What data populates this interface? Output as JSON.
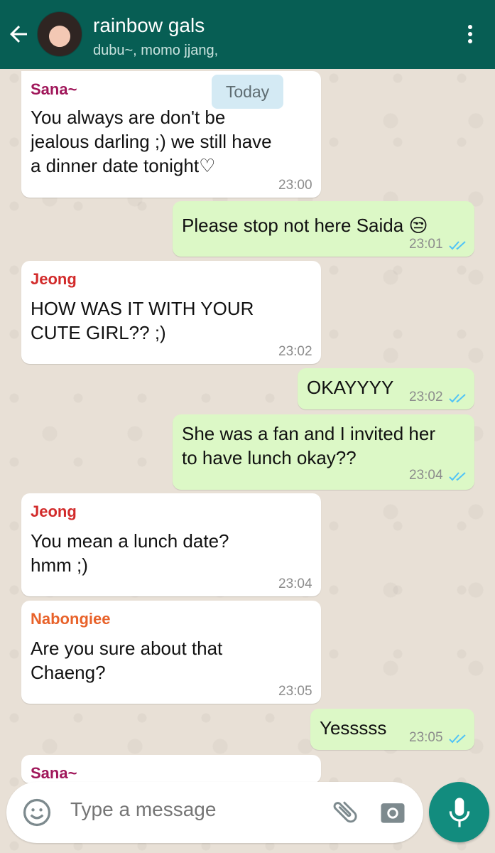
{
  "header": {
    "title": "rainbow gals",
    "subtitle": "dubu~, momo jjang,",
    "back_icon": "arrow-left-icon",
    "menu_icon": "more-vert-icon",
    "colors": {
      "bar": "#075e54",
      "text": "#ffffff"
    }
  },
  "date_chip": "Today",
  "messages": [
    {
      "direction": "incoming",
      "sender": "Sana~",
      "sender_color": "#a0175a",
      "lines": [
        "You always are don't be",
        "jealous darling ;) we still have",
        "a dinner date tonight♡"
      ],
      "time": "23:00"
    },
    {
      "direction": "outgoing",
      "lines": [
        "Please stop not here Saida 😒"
      ],
      "time": "23:01",
      "status": "read"
    },
    {
      "direction": "incoming",
      "sender": "Jeong",
      "sender_color": "#d22b2b",
      "lines": [
        "HOW WAS IT WITH YOUR",
        "CUTE GIRL?? ;)"
      ],
      "time": "23:02"
    },
    {
      "direction": "outgoing",
      "lines": [
        "OKAYYYY"
      ],
      "time": "23:02",
      "status": "read"
    },
    {
      "direction": "outgoing",
      "lines": [
        "She was a fan and I invited her",
        "to have lunch okay??"
      ],
      "time": "23:04",
      "status": "read"
    },
    {
      "direction": "incoming",
      "sender": "Jeong",
      "sender_color": "#d22b2b",
      "lines": [
        "You mean a lunch date?",
        "hmm ;)"
      ],
      "time": "23:04"
    },
    {
      "direction": "incoming",
      "sender": "Nabongiee",
      "sender_color": "#e8622a",
      "lines": [
        "Are you sure about that",
        "Chaeng?"
      ],
      "time": "23:05"
    },
    {
      "direction": "outgoing",
      "lines": [
        "Yesssss"
      ],
      "time": "23:05",
      "status": "read"
    },
    {
      "direction": "incoming",
      "sender": "Sana~",
      "sender_color": "#a0175a",
      "lines": [],
      "time": ""
    }
  ],
  "composer": {
    "placeholder": "Type a message",
    "emoji_icon": "smiley-icon",
    "attach_icon": "paperclip-icon",
    "camera_icon": "camera-icon",
    "mic_icon": "microphone-icon"
  },
  "colors": {
    "incoming_bubble": "#ffffff",
    "outgoing_bubble": "#dcf8c6",
    "read_tick": "#4fc3f7",
    "mic_button": "#128c7e"
  }
}
